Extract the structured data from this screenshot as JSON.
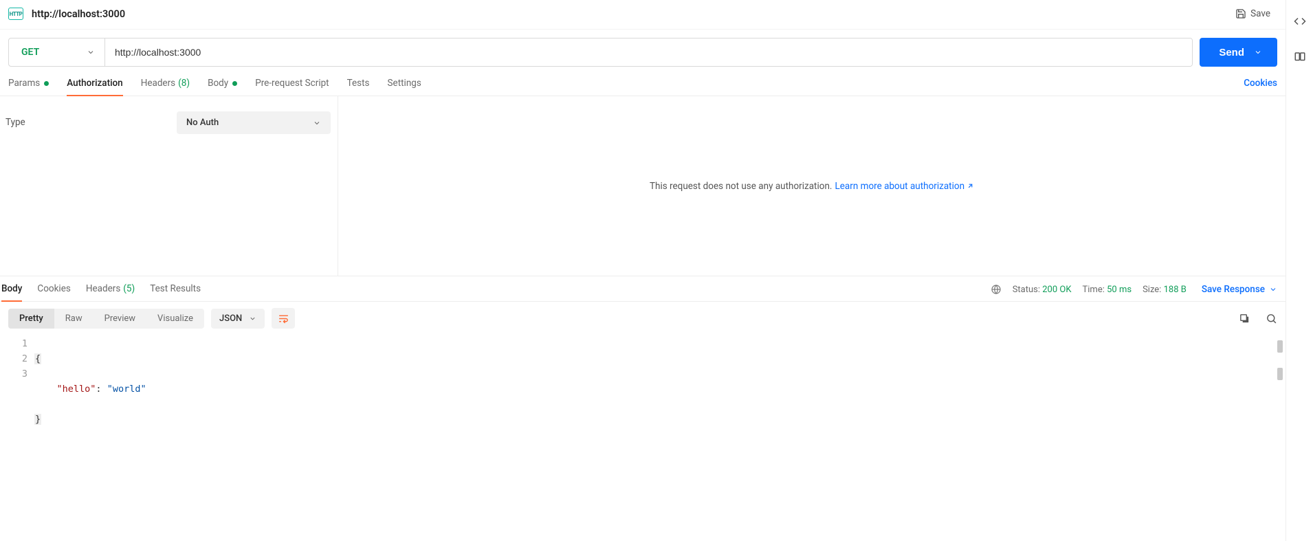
{
  "titlebar": {
    "http_badge": "HTTP",
    "title": "http://localhost:3000",
    "save_label": "Save"
  },
  "request": {
    "method": "GET",
    "url": "http://localhost:3000",
    "send_label": "Send"
  },
  "request_tabs": {
    "params": "Params",
    "authorization": "Authorization",
    "headers": "Headers",
    "headers_count": "(8)",
    "body": "Body",
    "prerequest": "Pre-request Script",
    "tests": "Tests",
    "settings": "Settings",
    "cookies": "Cookies"
  },
  "auth": {
    "type_label": "Type",
    "selected": "No Auth",
    "message": "This request does not use any authorization.",
    "link": "Learn more about authorization"
  },
  "response_tabs": {
    "body": "Body",
    "cookies": "Cookies",
    "headers": "Headers",
    "headers_count": "(5)",
    "test_results": "Test Results"
  },
  "response_meta": {
    "status_label": "Status:",
    "status_value": "200 OK",
    "time_label": "Time:",
    "time_value": "50 ms",
    "size_label": "Size:",
    "size_value": "188 B",
    "save_response": "Save Response"
  },
  "view": {
    "pretty": "Pretty",
    "raw": "Raw",
    "preview": "Preview",
    "visualize": "Visualize",
    "format": "JSON"
  },
  "code": {
    "line1_num": "1",
    "line2_num": "2",
    "line3_num": "3",
    "brace_open": "{",
    "brace_close": "}",
    "key": "\"hello\"",
    "colon": ":",
    "value": "\"world\""
  }
}
